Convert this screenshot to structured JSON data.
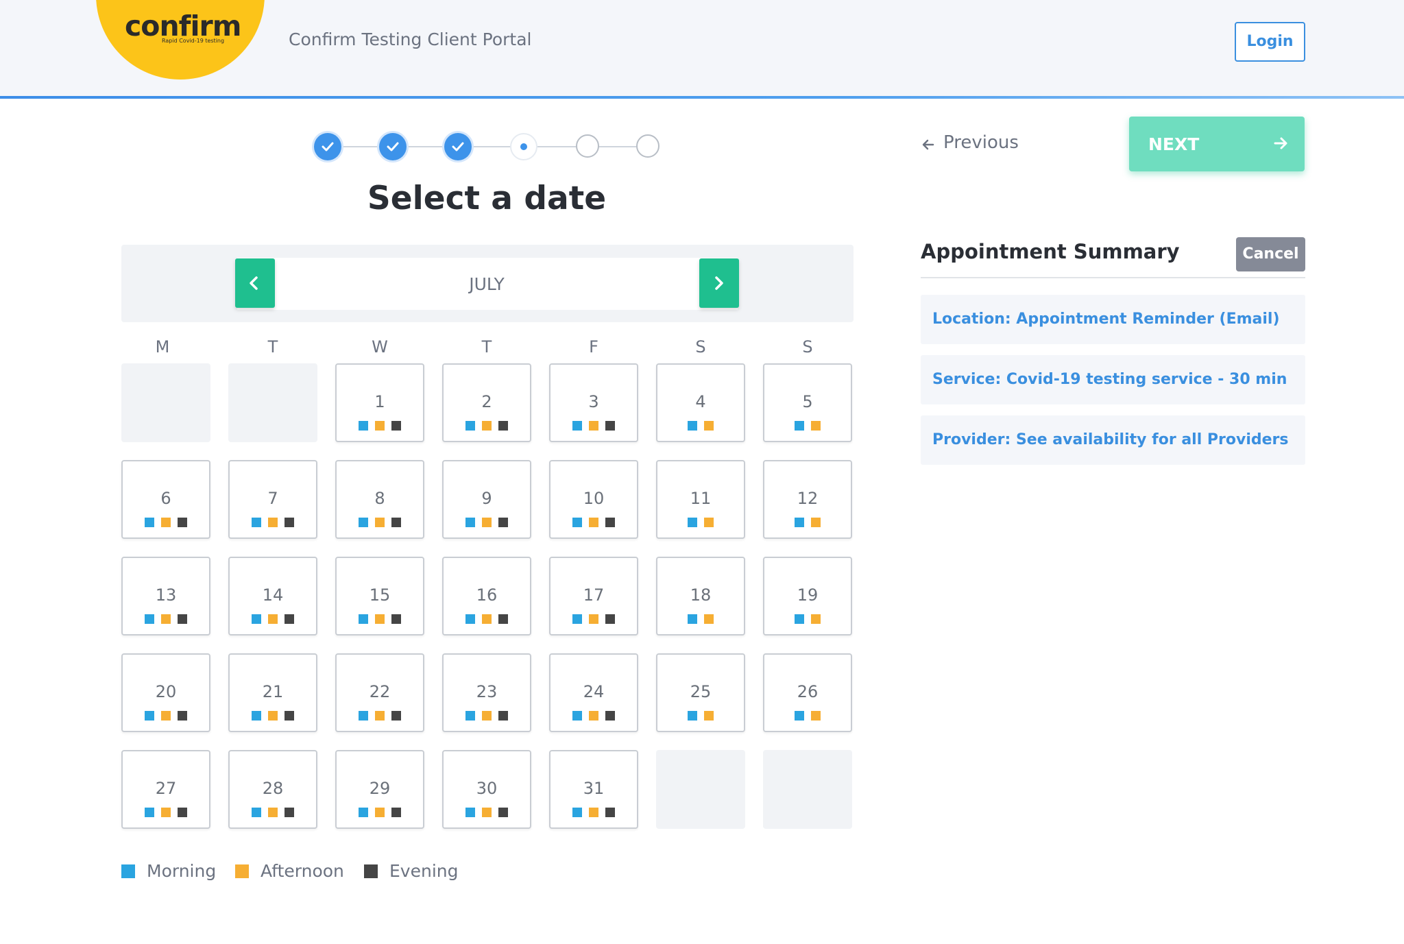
{
  "header": {
    "logo_text": "confirm",
    "logo_subtext": "Rapid Covid-19 testing",
    "portal_title": "Confirm Testing Client Portal",
    "login_label": "Login"
  },
  "stepper": {
    "total_steps": 6,
    "completed_steps": 3,
    "current_step": 4
  },
  "page_title": "Select a date",
  "calendar": {
    "month": "JULY",
    "weekdays": [
      "M",
      "T",
      "W",
      "T",
      "F",
      "S",
      "S"
    ],
    "days": [
      {
        "num": "1",
        "slots": [
          "morning",
          "afternoon",
          "evening"
        ]
      },
      {
        "num": "2",
        "slots": [
          "morning",
          "afternoon",
          "evening"
        ]
      },
      {
        "num": "3",
        "slots": [
          "morning",
          "afternoon",
          "evening"
        ]
      },
      {
        "num": "4",
        "slots": [
          "morning",
          "afternoon"
        ]
      },
      {
        "num": "5",
        "slots": [
          "morning",
          "afternoon"
        ]
      },
      {
        "num": "6",
        "slots": [
          "morning",
          "afternoon",
          "evening"
        ]
      },
      {
        "num": "7",
        "slots": [
          "morning",
          "afternoon",
          "evening"
        ]
      },
      {
        "num": "8",
        "slots": [
          "morning",
          "afternoon",
          "evening"
        ]
      },
      {
        "num": "9",
        "slots": [
          "morning",
          "afternoon",
          "evening"
        ]
      },
      {
        "num": "10",
        "slots": [
          "morning",
          "afternoon",
          "evening"
        ]
      },
      {
        "num": "11",
        "slots": [
          "morning",
          "afternoon"
        ]
      },
      {
        "num": "12",
        "slots": [
          "morning",
          "afternoon"
        ]
      },
      {
        "num": "13",
        "slots": [
          "morning",
          "afternoon",
          "evening"
        ]
      },
      {
        "num": "14",
        "slots": [
          "morning",
          "afternoon",
          "evening"
        ]
      },
      {
        "num": "15",
        "slots": [
          "morning",
          "afternoon",
          "evening"
        ]
      },
      {
        "num": "16",
        "slots": [
          "morning",
          "afternoon",
          "evening"
        ]
      },
      {
        "num": "17",
        "slots": [
          "morning",
          "afternoon",
          "evening"
        ]
      },
      {
        "num": "18",
        "slots": [
          "morning",
          "afternoon"
        ]
      },
      {
        "num": "19",
        "slots": [
          "morning",
          "afternoon"
        ]
      },
      {
        "num": "20",
        "slots": [
          "morning",
          "afternoon",
          "evening"
        ]
      },
      {
        "num": "21",
        "slots": [
          "morning",
          "afternoon",
          "evening"
        ]
      },
      {
        "num": "22",
        "slots": [
          "morning",
          "afternoon",
          "evening"
        ]
      },
      {
        "num": "23",
        "slots": [
          "morning",
          "afternoon",
          "evening"
        ]
      },
      {
        "num": "24",
        "slots": [
          "morning",
          "afternoon",
          "evening"
        ]
      },
      {
        "num": "25",
        "slots": [
          "morning",
          "afternoon"
        ]
      },
      {
        "num": "26",
        "slots": [
          "morning",
          "afternoon"
        ]
      },
      {
        "num": "27",
        "slots": [
          "morning",
          "afternoon",
          "evening"
        ]
      },
      {
        "num": "28",
        "slots": [
          "morning",
          "afternoon",
          "evening"
        ]
      },
      {
        "num": "29",
        "slots": [
          "morning",
          "afternoon",
          "evening"
        ]
      },
      {
        "num": "30",
        "slots": [
          "morning",
          "afternoon",
          "evening"
        ]
      },
      {
        "num": "31",
        "slots": [
          "morning",
          "afternoon",
          "evening"
        ]
      }
    ]
  },
  "legend": [
    {
      "key": "morning",
      "label": "Morning",
      "color": "#2aa4e0"
    },
    {
      "key": "afternoon",
      "label": "Afternoon",
      "color": "#f6ae33"
    },
    {
      "key": "evening",
      "label": "Evening",
      "color": "#454545"
    }
  ],
  "nav": {
    "previous_label": "Previous",
    "next_label": "NEXT"
  },
  "summary": {
    "title": "Appointment Summary",
    "cancel_label": "Cancel",
    "items": [
      "Location: Appointment Reminder (Email)",
      "Service: Covid-19 testing service - 30 min",
      "Provider: See availability for all Providers"
    ]
  },
  "colors": {
    "accent_blue": "#3a8fdf",
    "accent_green": "#1fbf8f",
    "logo_yellow": "#fcc419"
  },
  "icons": {
    "step_done": "check-icon",
    "month_prev": "chevron-left-icon",
    "month_next": "chevron-right-icon",
    "previous": "arrow-left-icon",
    "next": "arrow-right-icon"
  }
}
